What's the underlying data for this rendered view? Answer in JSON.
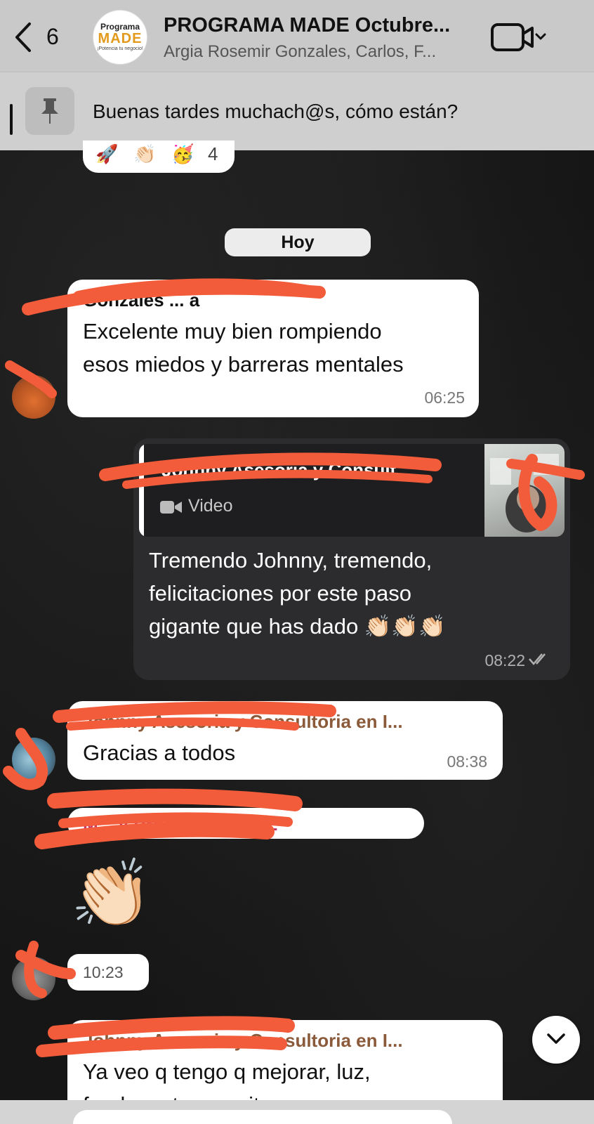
{
  "header": {
    "back_count": "6",
    "group_title": "PROGRAMA MADE Octubre...",
    "group_members": "Argia Rosemir Gonzales, Carlos, F...",
    "logo": {
      "top": "Programa",
      "mid": "MADE",
      "bottom": "¡Potencia tu negocio!"
    }
  },
  "pinned": {
    "text": "Buenas tardes muchach@s, cómo están?"
  },
  "reactions": {
    "emojis": [
      "🚀",
      "👏🏻",
      "🥳"
    ],
    "count": "4"
  },
  "date_chip": "Hoy",
  "messages": [
    {
      "sender": "Gonzales ... a",
      "sender_color": "#8a6a2a",
      "text_lines": [
        "Excelente muy bien rompiendo",
        "esos miedos y barreras mentales"
      ],
      "time": "06:25"
    },
    {
      "quote_sender": "Johnny Asesoria y Consult...",
      "quote_type": "Video",
      "text_lines": [
        "Tremendo Johnny, tremendo,",
        "felicitaciones por este paso",
        "gigante que has dado 👏🏻👏🏻👏🏻"
      ],
      "time": "08:22"
    },
    {
      "sender": "Johnny Asesoria y Consultoria en I...",
      "sender_color": "#8a5a3a",
      "text": "Gracias a todos",
      "time": "08:38"
    },
    {
      "sender": "M... y Programa MADE",
      "sender_color": "#c0306a",
      "emoji": "👏🏻",
      "time": "10:23"
    },
    {
      "sender": "Johnny Asesoria y Consultoria en I...",
      "sender_color": "#8a5a3a",
      "text_lines": [
        "Ya veo q tengo q mejorar, luz,",
        "fondo y otras cositas"
      ]
    }
  ],
  "colors": {
    "header_bg": "#c9c9c9",
    "outgoing_bubble": "#2c2c2e",
    "incoming_bubble": "#ffffff",
    "redaction": "#f25c3a"
  }
}
